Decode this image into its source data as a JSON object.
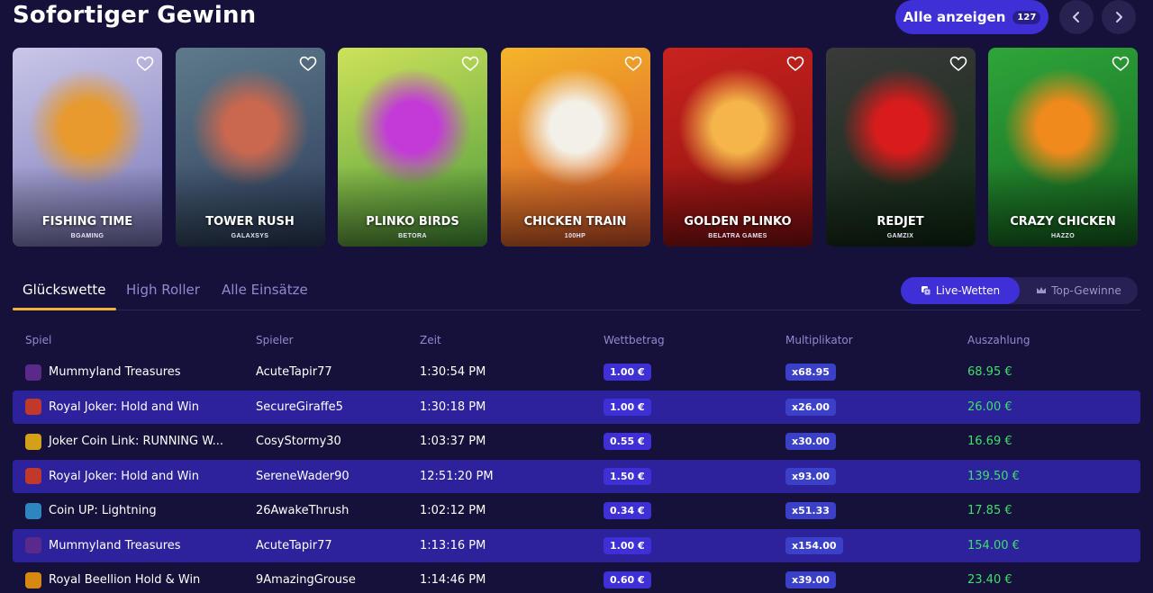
{
  "header": {
    "title": "Sofortiger Gewinn",
    "show_all_label": "Alle anzeigen",
    "show_all_count": "127"
  },
  "games": [
    {
      "name": "FISHING TIME",
      "provider": "BGAMING",
      "colors": [
        "#c9c6e8",
        "#7a78b8"
      ],
      "accent": "#e89a2c"
    },
    {
      "name": "TOWER RUSH",
      "provider": "GALAXSYS",
      "colors": [
        "#5e7a8a",
        "#2c3c5a"
      ],
      "accent": "#c9684e"
    },
    {
      "name": "PLINKO BIRDS",
      "provider": "BETORA",
      "colors": [
        "#cde25a",
        "#4a9a3a"
      ],
      "accent": "#c33ad8"
    },
    {
      "name": "CHICKEN TRAIN",
      "provider": "100HP",
      "colors": [
        "#f5b52a",
        "#d9532a"
      ],
      "accent": "#f3f0e8"
    },
    {
      "name": "GOLDEN PLINKO",
      "provider": "BELATRA GAMES",
      "colors": [
        "#c9231e",
        "#8a1010"
      ],
      "accent": "#f4b64a"
    },
    {
      "name": "REDJET",
      "provider": "GAMZIX",
      "colors": [
        "#3a3a3a",
        "#0f2a12"
      ],
      "accent": "#d81c1c"
    },
    {
      "name": "CRAZY CHICKEN",
      "provider": "HAZZO",
      "colors": [
        "#2ea63a",
        "#15631e"
      ],
      "accent": "#f08a1c"
    }
  ],
  "tabs": {
    "items": [
      "Glückswette",
      "High Roller",
      "Alle Einsätze"
    ],
    "active": "Glückswette"
  },
  "toggle": {
    "live_label": "Live-Wetten",
    "top_label": "Top-Gewinne"
  },
  "table": {
    "headers": [
      "Spiel",
      "Spieler",
      "Zeit",
      "Wettbetrag",
      "Multiplikator",
      "Auszahlung"
    ],
    "rows": [
      {
        "game": "Mummyland Treasures",
        "player": "AcuteTapir77",
        "time": "1:30:54 PM",
        "bet": "1.00 €",
        "mult": "x68.95",
        "payout": "68.95 €",
        "icon_color": "#5a2a8a"
      },
      {
        "game": "Royal Joker: Hold and Win",
        "player": "SecureGiraffe5",
        "time": "1:30:18 PM",
        "bet": "1.00 €",
        "mult": "x26.00",
        "payout": "26.00 €",
        "icon_color": "#c0392b"
      },
      {
        "game": "Joker Coin Link: RUNNING W...",
        "player": "CosyStormy30",
        "time": "1:03:37 PM",
        "bet": "0.55 €",
        "mult": "x30.00",
        "payout": "16.69 €",
        "icon_color": "#d4a017"
      },
      {
        "game": "Royal Joker: Hold and Win",
        "player": "SereneWader90",
        "time": "12:51:20 PM",
        "bet": "1.50 €",
        "mult": "x93.00",
        "payout": "139.50 €",
        "icon_color": "#c0392b"
      },
      {
        "game": "Coin UP: Lightning",
        "player": "26AwakeThrush",
        "time": "1:02:12 PM",
        "bet": "0.34 €",
        "mult": "x51.33",
        "payout": "17.85 €",
        "icon_color": "#2e86c1"
      },
      {
        "game": "Mummyland Treasures",
        "player": "AcuteTapir77",
        "time": "1:13:16 PM",
        "bet": "1.00 €",
        "mult": "x154.00",
        "payout": "154.00 €",
        "icon_color": "#5a2a8a"
      },
      {
        "game": "Royal Beellion Hold & Win",
        "player": "9AmazingGrouse",
        "time": "1:14:46 PM",
        "bet": "0.60 €",
        "mult": "x39.00",
        "payout": "23.40 €",
        "icon_color": "#d68910"
      }
    ]
  }
}
